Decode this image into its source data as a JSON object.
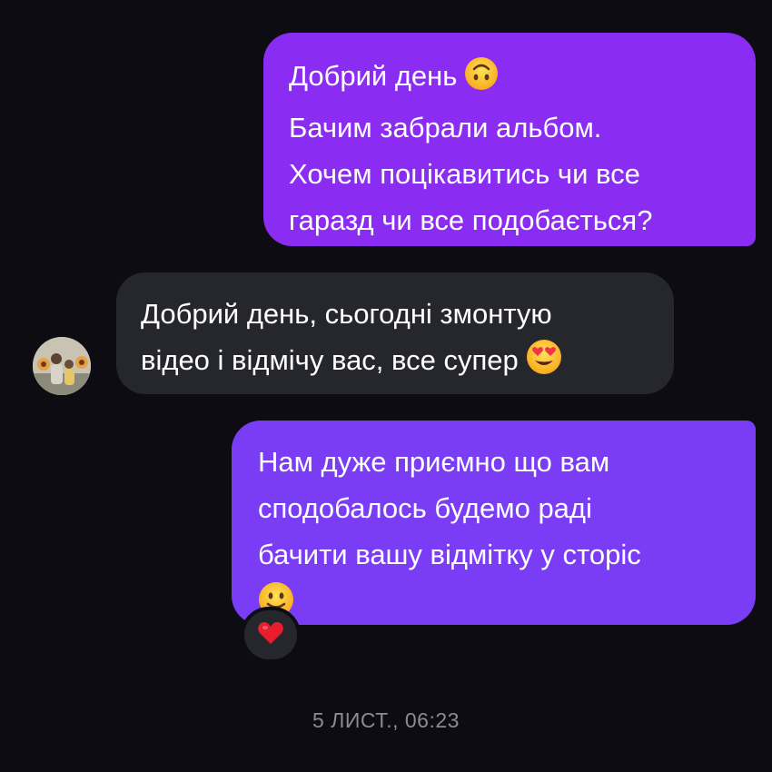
{
  "conversation": {
    "messages": [
      {
        "direction": "outgoing",
        "lines": [
          "Добрий день",
          "Бачим забрали альбом.",
          "Хочем поцікавитись чи все",
          "гаразд чи все подобається?"
        ],
        "emoji": "upside-down-face"
      },
      {
        "direction": "incoming",
        "lines": [
          "Добрий день, сьогодні змонтую",
          "відео і відмічу вас, все супер"
        ],
        "emoji": "heart-eyes-face"
      },
      {
        "direction": "outgoing",
        "lines": [
          "Нам дуже приємно що вам",
          "сподобалось будемо раді",
          "бачити вашу відмітку у сторіс"
        ],
        "emoji": "slightly-smiling-face",
        "reaction": "red-heart"
      }
    ],
    "timestamp": "5 ЛИСТ., 06:23"
  },
  "colors": {
    "background": "#0c0c12",
    "outgoing_bubble": "#8b2cf2",
    "outgoing_bubble_2": "#7a3df5",
    "incoming_bubble": "#26262d",
    "timestamp_text": "#8b8b93"
  }
}
